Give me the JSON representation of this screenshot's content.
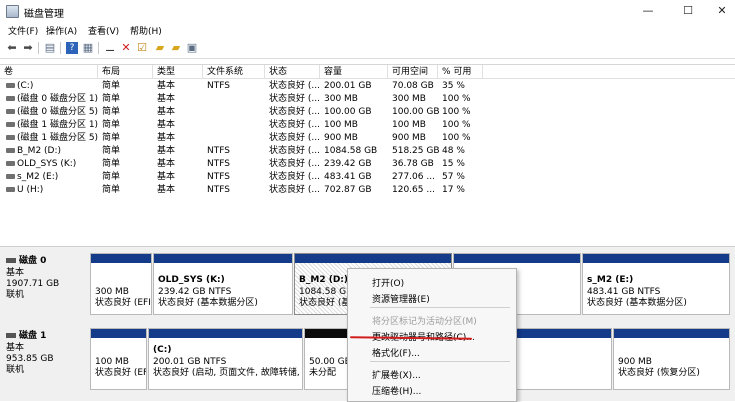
{
  "window": {
    "title": "磁盘管理",
    "controls": {
      "minimize": "—",
      "maximize": "☐",
      "close": "✕"
    }
  },
  "menu": [
    "文件(F)",
    "操作(A)",
    "查看(V)",
    "帮助(H)"
  ],
  "toolbar": {
    "icons": [
      "back-arrow-icon",
      "forward-arrow-icon",
      "view-list-icon",
      "help-icon",
      "properties-icon",
      "connect-icon",
      "delete-icon",
      "check-icon",
      "folder-icon",
      "folder-settings-icon",
      "info-icon"
    ]
  },
  "volume_table": {
    "columns": [
      "卷",
      "布局",
      "类型",
      "文件系统",
      "状态",
      "容量",
      "可用空间",
      "% 可用"
    ],
    "rows": [
      [
        "(C:)",
        "简单",
        "基本",
        "NTFS",
        "状态良好 (...",
        "200.01 GB",
        "70.08 GB",
        "35 %"
      ],
      [
        "(磁盘 0 磁盘分区 1)",
        "简单",
        "基本",
        "",
        "状态良好 (...",
        "300 MB",
        "300 MB",
        "100 %"
      ],
      [
        "(磁盘 0 磁盘分区 5)",
        "简单",
        "基本",
        "",
        "状态良好 (...",
        "100.00 GB",
        "100.00 GB",
        "100 %"
      ],
      [
        "(磁盘 1 磁盘分区 1)",
        "简单",
        "基本",
        "",
        "状态良好 (...",
        "100 MB",
        "100 MB",
        "100 %"
      ],
      [
        "(磁盘 1 磁盘分区 5)",
        "简单",
        "基本",
        "",
        "状态良好 (...",
        "900 MB",
        "900 MB",
        "100 %"
      ],
      [
        "B_M2 (D:)",
        "简单",
        "基本",
        "NTFS",
        "状态良好 (...",
        "1084.58 GB",
        "518.25 GB",
        "48 %"
      ],
      [
        "OLD_SYS (K:)",
        "简单",
        "基本",
        "NTFS",
        "状态良好 (...",
        "239.42 GB",
        "36.78 GB",
        "15 %"
      ],
      [
        "s_M2 (E:)",
        "简单",
        "基本",
        "NTFS",
        "状态良好 (...",
        "483.41 GB",
        "277.06 ...",
        "57 %"
      ],
      [
        "U (H:)",
        "简单",
        "基本",
        "NTFS",
        "状态良好 (...",
        "702.87 GB",
        "120.65 ...",
        "17 %"
      ]
    ]
  },
  "disks": [
    {
      "name": "磁盘 0",
      "type": "基本",
      "size": "1907.71 GB",
      "status": "联机",
      "partitions": [
        {
          "line1": "",
          "line2": "300 MB",
          "line3": "状态良好 (EFI"
        },
        {
          "line1": "OLD_SYS  (K:)",
          "line2": "239.42 GB NTFS",
          "line3": "状态良好 (基本数据分区)"
        },
        {
          "line1": "B_M2  (D:)",
          "line2": "1084.58 G",
          "line3": "状态良好 (基"
        },
        {
          "line1": "",
          "line2": "",
          "line3": ""
        },
        {
          "line1": "s_M2  (E:)",
          "line2": "483.41 GB NTFS",
          "line3": "状态良好 (基本数据分区)"
        }
      ]
    },
    {
      "name": "磁盘 1",
      "type": "基本",
      "size": "953.85 GB",
      "status": "联机",
      "partitions": [
        {
          "line1": "",
          "line2": "100 MB",
          "line3": "状态良好 (EFI"
        },
        {
          "line1": "(C:)",
          "line2": "200.01 GB NTFS",
          "line3": "状态良好 (启动, 页面文件, 故障转储, 基"
        },
        {
          "line1": "",
          "line2": "50.00 GB",
          "line3": "未分配"
        },
        {
          "line1": "",
          "line2": "",
          "line3": ""
        },
        {
          "line1": "",
          "line2": "900 MB",
          "line3": "状态良好 (恢复分区)"
        }
      ]
    }
  ],
  "context_menu": {
    "items": [
      {
        "label": "打开(O)",
        "enabled": true
      },
      {
        "label": "资源管理器(E)",
        "enabled": true
      },
      {
        "label": "将分区标记为活动分区(M)",
        "enabled": false
      },
      {
        "label": "更改驱动器号和路径(C)...",
        "enabled": true
      },
      {
        "label": "格式化(F)...",
        "enabled": true
      },
      {
        "label": "扩展卷(X)...",
        "enabled": true
      },
      {
        "label": "压缩卷(H)...",
        "enabled": true
      }
    ]
  },
  "colors": {
    "partition_bar": "#143a8a",
    "unallocated_bar": "#0b0b0b",
    "annotation": "#d21d1d"
  }
}
